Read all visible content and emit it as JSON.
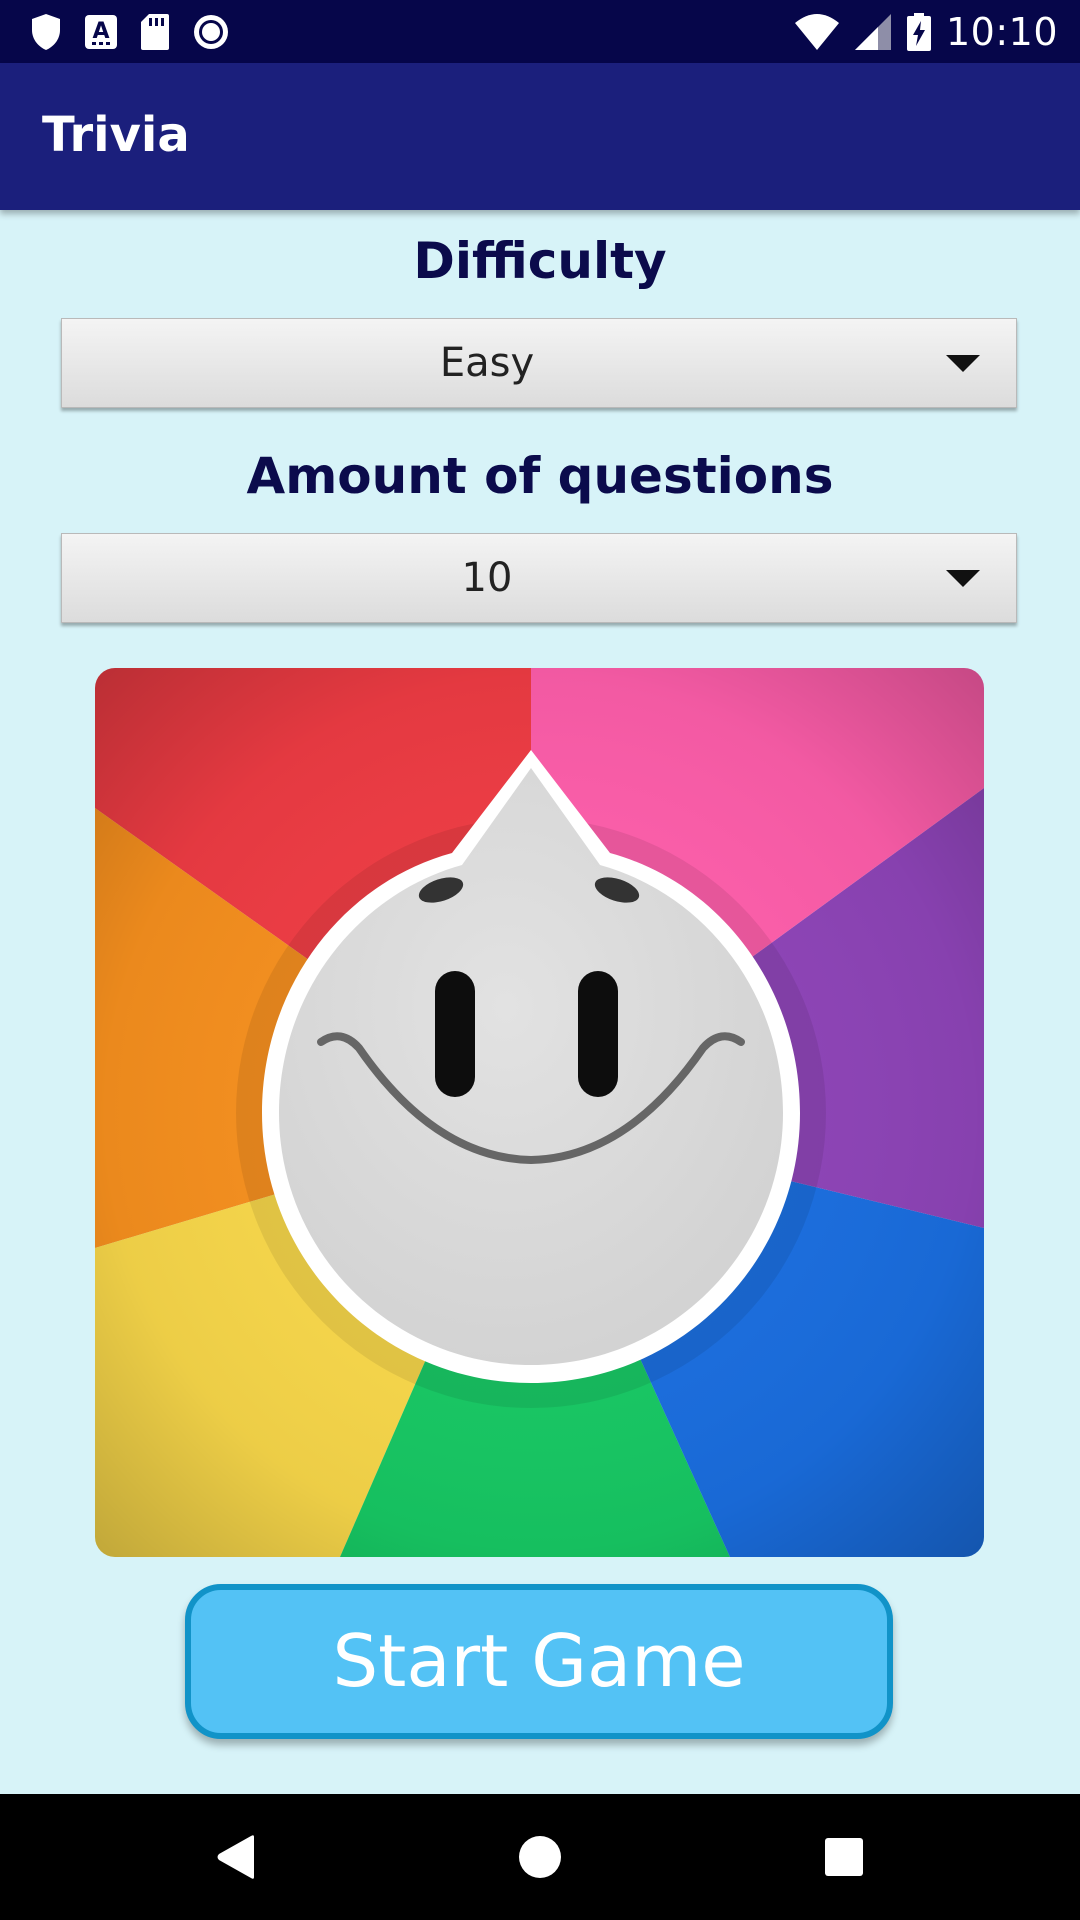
{
  "status_bar": {
    "time": "10:10",
    "left_icons": [
      "shield-icon",
      "font-a-icon",
      "sd-card-icon",
      "radio-icon"
    ],
    "right_icons": [
      "wifi-icon",
      "cell-signal-icon",
      "battery-charging-icon"
    ]
  },
  "app_bar": {
    "title": "Trivia"
  },
  "form": {
    "difficulty": {
      "label": "Difficulty",
      "selected": "Easy"
    },
    "amount": {
      "label": "Amount of questions",
      "selected": "10"
    }
  },
  "logo": {
    "icon": "trivia-mascot-icon",
    "colors": [
      "#f03c44",
      "#ff5eab",
      "#8e44b8",
      "#1a6ee0",
      "#17c964",
      "#f9d84a",
      "#f7901e"
    ]
  },
  "start_button": {
    "label": "Start Game",
    "color": "#53c2f5",
    "border_color": "#1193c8"
  },
  "nav_bar": {
    "icons": [
      "back-icon",
      "home-icon",
      "recents-icon"
    ]
  },
  "colors": {
    "status_bar": "#06064a",
    "app_bar": "#1b1f7c",
    "background": "#d7f3f8",
    "label_text": "#0b0b4c"
  }
}
